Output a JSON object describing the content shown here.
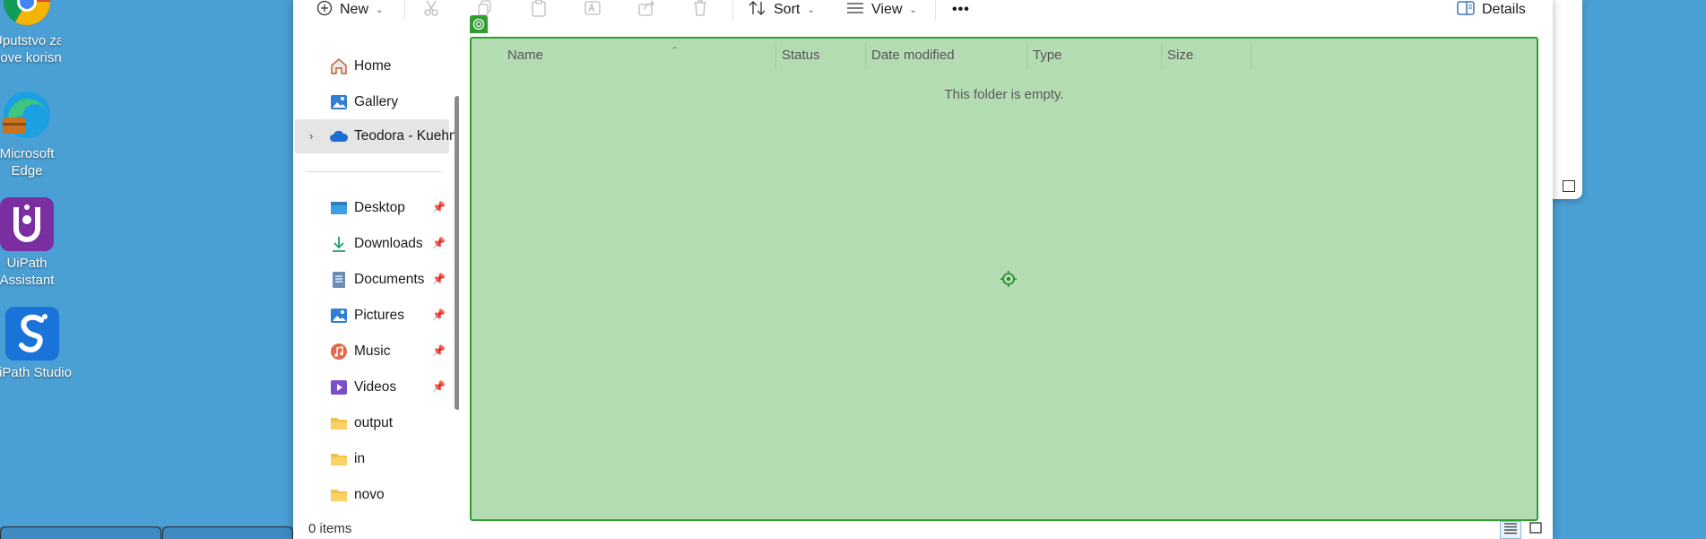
{
  "desktop": {
    "icons": [
      {
        "label1": "Uputstvo za",
        "label2": "nove korisn...",
        "icon": "chrome-icon"
      },
      {
        "label1": "Microsoft",
        "label2": "Edge",
        "icon": "edge-icon"
      },
      {
        "label1": "UiPath",
        "label2": "Assistant",
        "icon": "uipath-assistant-icon"
      },
      {
        "label1": "UiPath Studio",
        "label2": "",
        "icon": "uipath-studio-icon"
      }
    ]
  },
  "toolbar": {
    "new_label": "New",
    "sort_label": "Sort",
    "view_label": "View",
    "more_label": "•••",
    "details_label": "Details"
  },
  "nav": {
    "items": [
      {
        "label": "Home",
        "icon": "home-icon"
      },
      {
        "label": "Gallery",
        "icon": "gallery-icon"
      },
      {
        "label": "Teodora - Kuehne",
        "icon": "onedrive-icon",
        "selected": true
      },
      {
        "label": "Desktop",
        "icon": "desktop-folder-icon",
        "pinned": true
      },
      {
        "label": "Downloads",
        "icon": "downloads-icon",
        "pinned": true
      },
      {
        "label": "Documents",
        "icon": "documents-icon",
        "pinned": true
      },
      {
        "label": "Pictures",
        "icon": "pictures-icon",
        "pinned": true
      },
      {
        "label": "Music",
        "icon": "music-icon",
        "pinned": true
      },
      {
        "label": "Videos",
        "icon": "videos-icon",
        "pinned": true
      },
      {
        "label": "output",
        "icon": "folder-icon"
      },
      {
        "label": "in",
        "icon": "folder-icon"
      },
      {
        "label": "novo",
        "icon": "folder-icon"
      }
    ]
  },
  "content": {
    "columns": [
      "Name",
      "Status",
      "Date modified",
      "Type",
      "Size"
    ],
    "empty_message": "This folder is empty."
  },
  "statusbar": {
    "item_count": "0 items"
  },
  "colors": {
    "desktop_bg": "#4a9fd4",
    "highlight_fill": "#b3dcb3",
    "highlight_border": "#2f9e2f",
    "selected_nav": "#e5e5e5"
  }
}
